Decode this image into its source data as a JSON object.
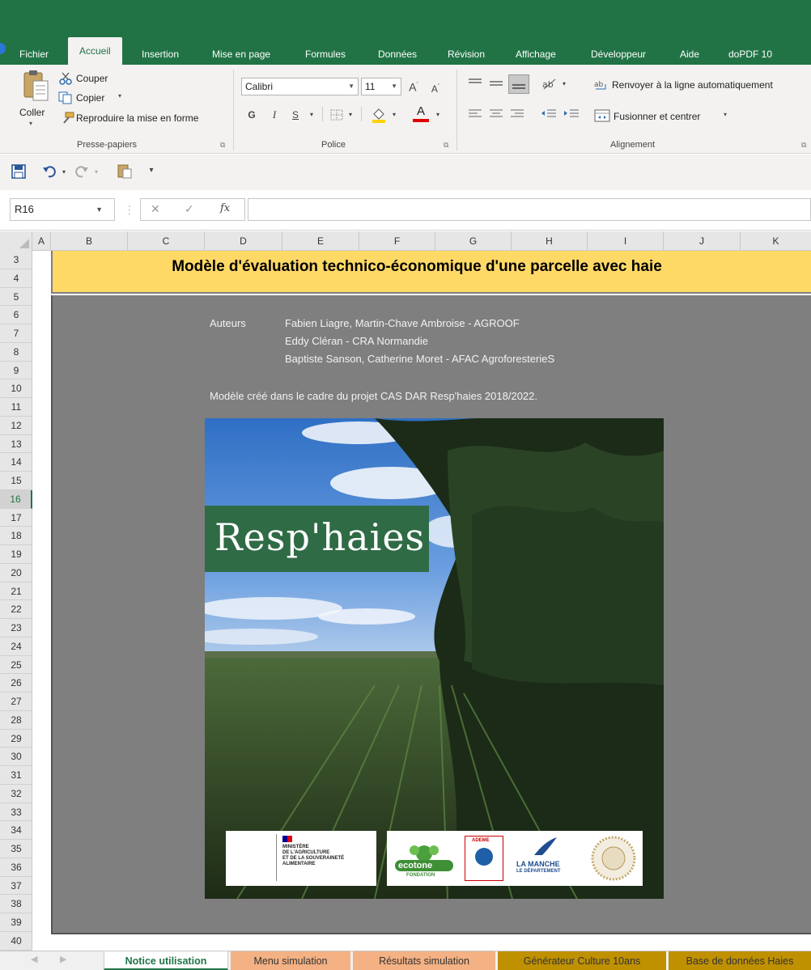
{
  "ribbon_tabs": [
    {
      "label": "Fichier",
      "active": false
    },
    {
      "label": "Accueil",
      "active": true
    },
    {
      "label": "Insertion",
      "active": false
    },
    {
      "label": "Mise en page",
      "active": false
    },
    {
      "label": "Formules",
      "active": false
    },
    {
      "label": "Données",
      "active": false
    },
    {
      "label": "Révision",
      "active": false
    },
    {
      "label": "Affichage",
      "active": false
    },
    {
      "label": "Développeur",
      "active": false
    },
    {
      "label": "Aide",
      "active": false
    },
    {
      "label": "doPDF 10",
      "active": false
    }
  ],
  "clipboard": {
    "paste": "Coller",
    "cut": "Couper",
    "copy": "Copier",
    "format_painter": "Reproduire la mise en forme",
    "group_label": "Presse-papiers"
  },
  "font": {
    "name": "Calibri",
    "size": "11",
    "bold": "G",
    "italic": "I",
    "underline": "S",
    "grow": "A",
    "shrink": "A",
    "color_glyph": "A",
    "group_label": "Police"
  },
  "alignment": {
    "wrap_text": "Renvoyer à la ligne automatiquement",
    "merge_center": "Fusionner et centrer",
    "group_label": "Alignement"
  },
  "formula_bar": {
    "name_box": "R16",
    "fx": "fx",
    "cancel": "✕",
    "enter": "✓",
    "value": ""
  },
  "columns": [
    "A",
    "B",
    "C",
    "D",
    "E",
    "F",
    "G",
    "H",
    "I",
    "J",
    "K"
  ],
  "rows": [
    "3",
    "4",
    "5",
    "6",
    "7",
    "8",
    "9",
    "10",
    "11",
    "12",
    "13",
    "14",
    "15",
    "16",
    "17",
    "18",
    "19",
    "20",
    "21",
    "22",
    "23",
    "24",
    "25",
    "26",
    "27",
    "28",
    "29",
    "30",
    "31",
    "32",
    "33",
    "34",
    "35",
    "36",
    "37",
    "38",
    "39",
    "40"
  ],
  "selected_row": "16",
  "sheet": {
    "title": "Modèle d'évaluation technico-économique d'une parcelle avec haie",
    "authors_label": "Auteurs",
    "authors": [
      "Fabien Liagre, Martin-Chave Ambroise - AGROOF",
      "Eddy Cléran - CRA Normandie",
      "Baptiste Sanson, Catherine Moret - AFAC AgroforesterieS"
    ],
    "project_note": "Modèle créé dans le cadre du projet CAS DAR Resp'haies 2018/2022.",
    "poster_logo": "Resp'haies",
    "partners": {
      "ministry": [
        "MINISTÈRE",
        "DE L'AGRICULTURE",
        "ET DE LA SOUVERAINETÉ",
        "ALIMENTAIRE"
      ],
      "ecotone": "ecotone",
      "ecotone_sub": "FONDATION",
      "ademe": "ADEME",
      "manche": "LA MANCHE",
      "manche_sub": "LE DÉPARTEMENT"
    }
  },
  "sheet_tabs": [
    {
      "label": "Notice utilisation",
      "color": "#ffffff",
      "text": "#217346"
    },
    {
      "label": "Menu simulation",
      "color": "#f4b183",
      "text": "#333333"
    },
    {
      "label": "Résultats simulation",
      "color": "#f4b183",
      "text": "#333333"
    },
    {
      "label": "Générateur Culture 10ans",
      "color": "#bf9000",
      "text": "#333333"
    },
    {
      "label": "Base de données Haies",
      "color": "#bf9000",
      "text": "#333333"
    }
  ],
  "colors": {
    "excel_green": "#217346",
    "title_band": "#ffd966",
    "content_band": "#7f7f7f",
    "logo_green": "#2f6b45"
  }
}
